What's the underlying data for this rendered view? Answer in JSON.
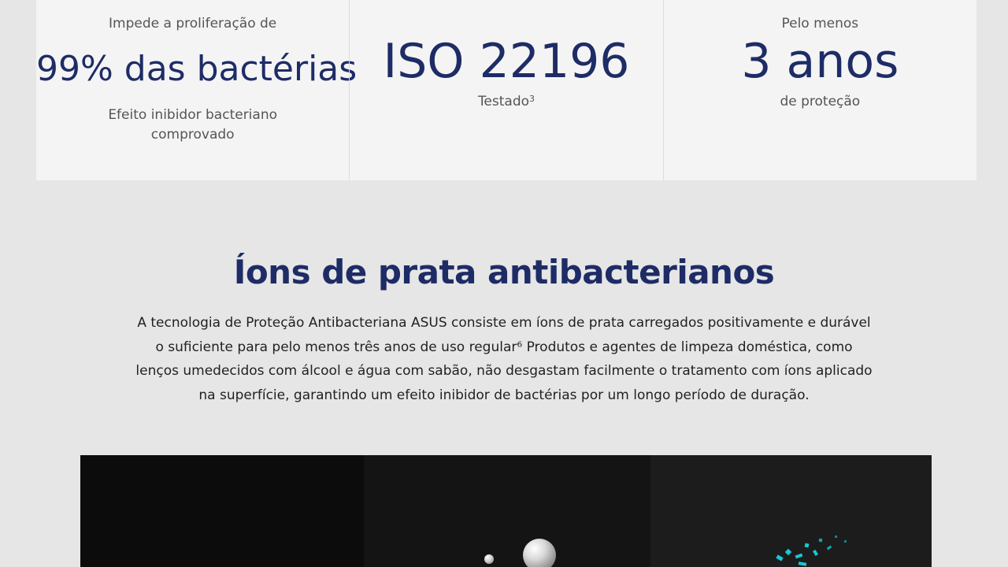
{
  "stats": [
    {
      "pre": "Impede a proliferação de",
      "big": "99% das bactérias",
      "post": "Efeito inibidor bacteriano comprovado"
    },
    {
      "pre": "",
      "big": "ISO 22196",
      "post": "Testado",
      "post_sup": "3"
    },
    {
      "pre": "Pelo menos",
      "big": "3 anos",
      "post": "de proteção"
    }
  ],
  "section": {
    "title": "Íons de prata antibacterianos",
    "description": "A tecnologia de Proteção Antibacteriana ASUS consiste em íons de prata carregados positivamente e durável o suficiente para pelo menos três anos de uso regular⁶ Produtos e agentes de limpeza doméstica, como lenços umedecidos com álcool e água com sabão, não desgastam facilmente o tratamento com íons aplicado na superfície, garantindo um efeito inibidor de bactérias por um longo período de duração."
  },
  "colors": {
    "background": "#e6e6e6",
    "card": "#f4f4f4",
    "accent": "#1e2c66",
    "ion_particles": "#17c8d2"
  }
}
